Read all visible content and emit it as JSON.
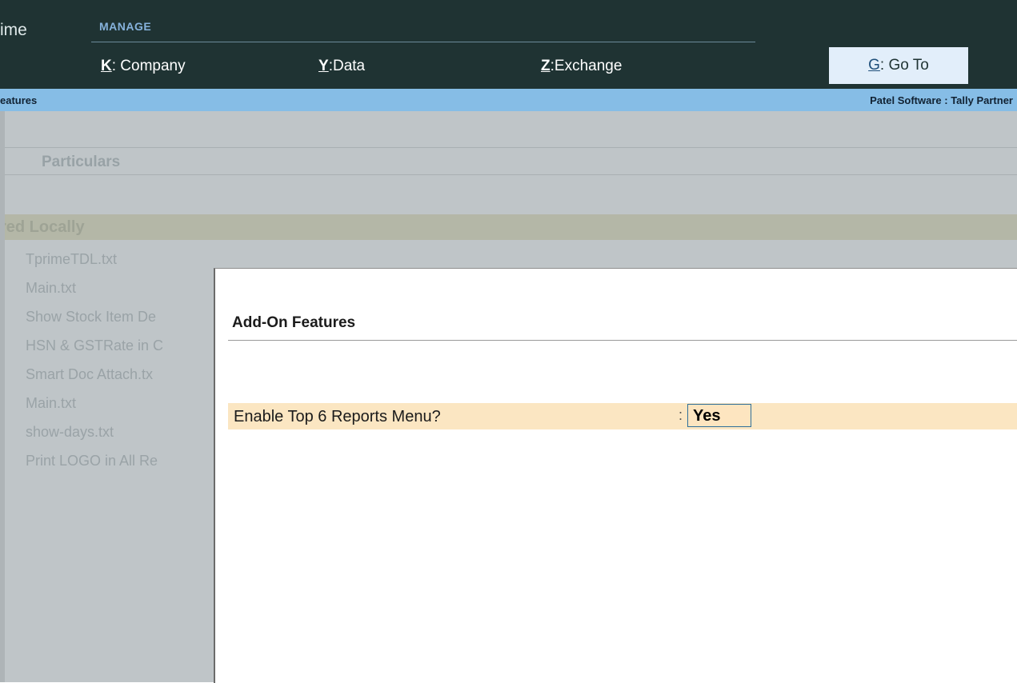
{
  "header": {
    "app_name_fragment": "ime",
    "manage_label": "MANAGE",
    "menu": [
      {
        "key": "K",
        "label": "Company"
      },
      {
        "key": "Y",
        "label": "Data"
      },
      {
        "key": "Z",
        "label": "Exchange"
      }
    ],
    "goto": {
      "key": "G",
      "label": "Go To"
    }
  },
  "infobar": {
    "left_text": "eatures",
    "right_text": "Patel Software : Tally Partner"
  },
  "background_report": {
    "column_header": "Particulars",
    "section_label": "red Locally",
    "items": [
      "TprimeTDL.txt",
      "Main.txt",
      "Show Stock Item De",
      "HSN & GSTRate in C",
      "Smart Doc Attach.tx",
      "Main.txt",
      "show-days.txt",
      "Print LOGO in All Re"
    ]
  },
  "dialog": {
    "title": "Add-On Features",
    "field": {
      "label": "Enable Top 6 Reports Menu?",
      "colon": ":",
      "value": "Yes"
    }
  }
}
